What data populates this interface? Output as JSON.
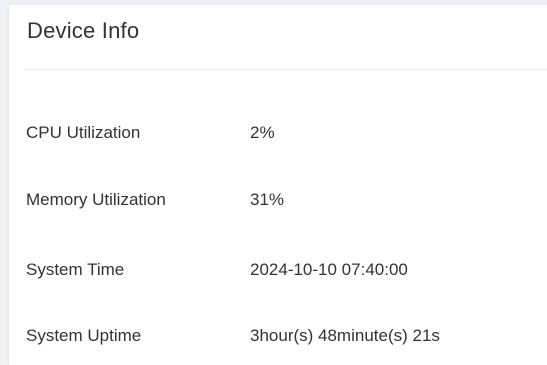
{
  "panel": {
    "title": "Device Info",
    "rows": [
      {
        "label": "CPU Utilization",
        "value": "2%"
      },
      {
        "label": "Memory Utilization",
        "value": "31%"
      },
      {
        "label": "System Time",
        "value": "2024-10-10 07:40:00"
      },
      {
        "label": "System Uptime",
        "value": "3hour(s) 48minute(s) 21s"
      }
    ]
  }
}
